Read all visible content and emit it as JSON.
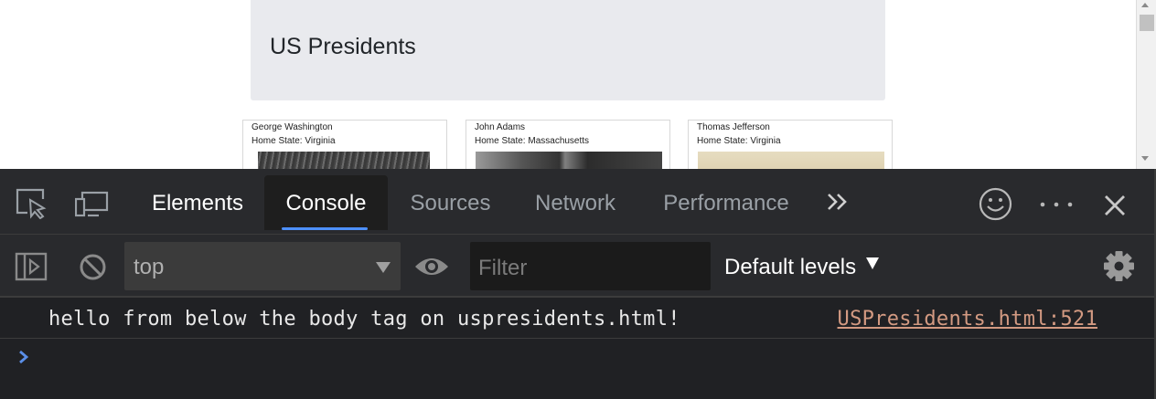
{
  "page": {
    "heading": "US Presidents",
    "cards": [
      {
        "name": "George Washington",
        "state": "Home State: Virginia"
      },
      {
        "name": "John Adams",
        "state": "Home State: Massachusetts"
      },
      {
        "name": "Thomas Jefferson",
        "state": "Home State: Virginia"
      }
    ]
  },
  "devtools": {
    "tabs": [
      {
        "label": "Elements"
      },
      {
        "label": "Console",
        "active": true
      },
      {
        "label": "Sources"
      },
      {
        "label": "Network"
      },
      {
        "label": "Performance"
      }
    ],
    "toolbar_icons": [
      "inspect-icon",
      "device-toggle-icon",
      "more-tabs-icon",
      "feedback-icon",
      "more-options-icon",
      "close-icon"
    ],
    "console_toolbar": {
      "context": "top",
      "filter_placeholder": "Filter",
      "filter_value": "",
      "levels": "Default levels"
    },
    "messages": [
      {
        "text": "hello from below the body tag on uspresidents.html!",
        "source": "USPresidents.html:521"
      }
    ],
    "colors": {
      "accent": "#4d90fe",
      "background": "#202124",
      "toolbar": "#292a2d",
      "link": "#d39a82",
      "prompt": "#5b8fe8"
    }
  }
}
